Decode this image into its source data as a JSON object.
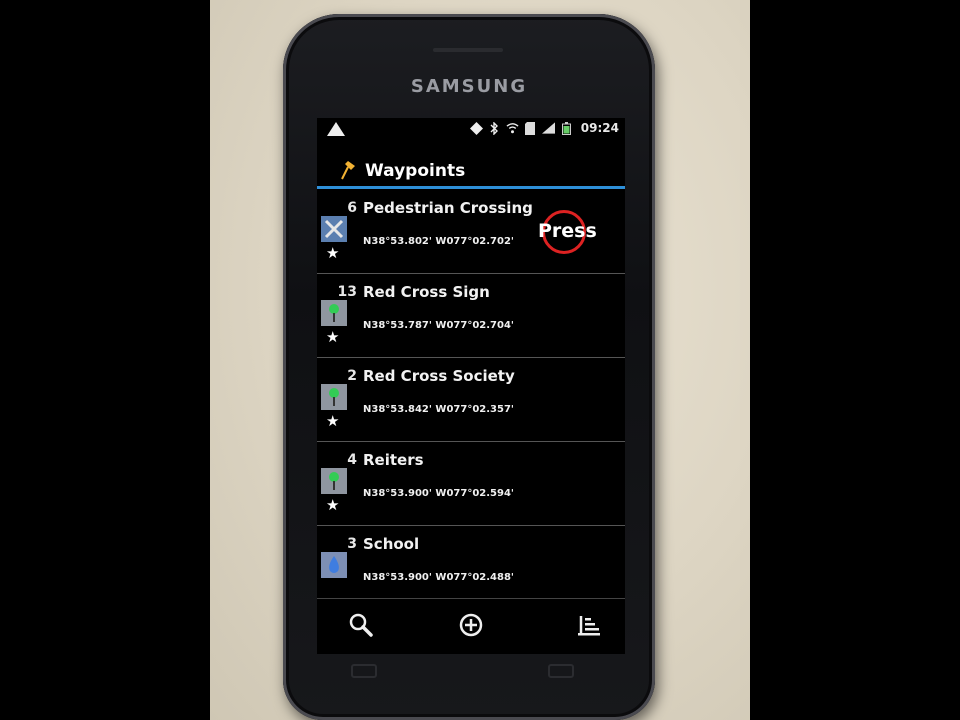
{
  "device": {
    "brand": "SAMSUNG"
  },
  "statusbar": {
    "time": "09:24"
  },
  "header": {
    "title": "Waypoints"
  },
  "overlay": {
    "press_label": "Press"
  },
  "waypoints": [
    {
      "num": "6",
      "name": "Pedestrian Crossing",
      "coord": "N38°53.802' W077°02.702'",
      "icon": "crossing-icon"
    },
    {
      "num": "13",
      "name": "Red Cross Sign",
      "coord": "N38°53.787' W077°02.704'",
      "icon": "green-pin-icon"
    },
    {
      "num": "2",
      "name": "Red Cross Society",
      "coord": "N38°53.842' W077°02.357'",
      "icon": "green-pin-icon"
    },
    {
      "num": "4",
      "name": "Reiters",
      "coord": "N38°53.900' W077°02.594'",
      "icon": "green-pin-icon"
    },
    {
      "num": "3",
      "name": "School",
      "coord": "N38°53.900' W077°02.488'",
      "icon": "water-drop-icon"
    }
  ],
  "colors": {
    "accent_line": "#2e8fd8",
    "press_ring": "#dd2222",
    "pin_green": "#33cc55"
  }
}
